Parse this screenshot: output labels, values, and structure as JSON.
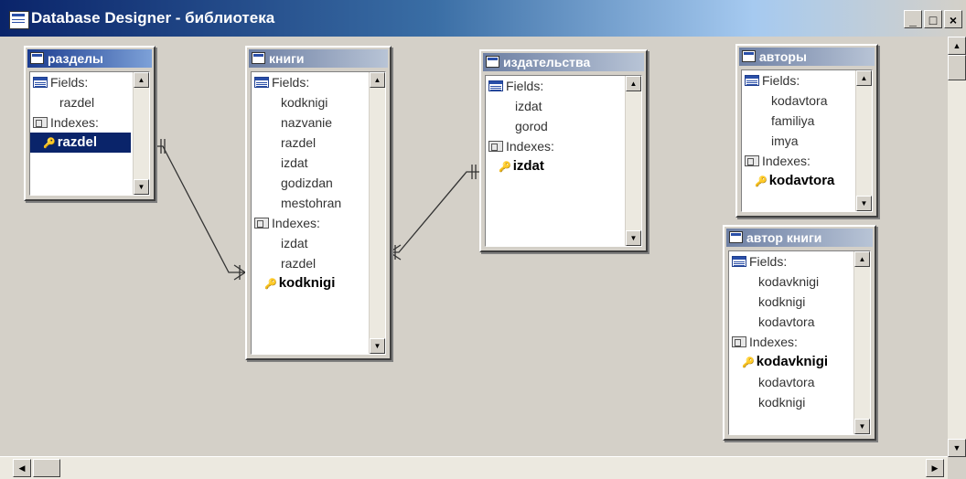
{
  "window": {
    "title": "Database Designer - библиотека",
    "minimize": "_",
    "maximize": "□",
    "close": "×"
  },
  "tables": [
    {
      "id": "razdely",
      "title": "разделы",
      "active": true,
      "fields_label": "Fields:",
      "fields": [
        "razdel"
      ],
      "indexes_label": "Indexes:",
      "indexes": [
        {
          "name": "razdel",
          "primary": true,
          "selected": true
        }
      ]
    },
    {
      "id": "knigi",
      "title": "книги",
      "active": false,
      "fields_label": "Fields:",
      "fields": [
        "kodknigi",
        "nazvanie",
        "razdel",
        "izdat",
        "godizdan",
        "mestohran"
      ],
      "indexes_label": "Indexes:",
      "indexes": [
        {
          "name": "izdat",
          "primary": false
        },
        {
          "name": "razdel",
          "primary": false
        },
        {
          "name": "kodknigi",
          "primary": true
        }
      ]
    },
    {
      "id": "izdatelstva",
      "title": "издательства",
      "active": false,
      "fields_label": "Fields:",
      "fields": [
        "izdat",
        "gorod"
      ],
      "indexes_label": "Indexes:",
      "indexes": [
        {
          "name": "izdat",
          "primary": true
        }
      ]
    },
    {
      "id": "avtory",
      "title": "авторы",
      "active": false,
      "fields_label": "Fields:",
      "fields": [
        "kodavtora",
        "familiya",
        "imya"
      ],
      "indexes_label": "Indexes:",
      "indexes": [
        {
          "name": "kodavtora",
          "primary": true
        }
      ]
    },
    {
      "id": "avtorknigi",
      "title": "автор книги",
      "active": false,
      "fields_label": "Fields:",
      "fields": [
        "kodavknigi",
        "kodknigi",
        "kodavtora"
      ],
      "indexes_label": "Indexes:",
      "indexes": [
        {
          "name": "kodavknigi",
          "primary": true
        },
        {
          "name": "kodavtora",
          "primary": false
        },
        {
          "name": "kodknigi",
          "primary": false
        }
      ]
    }
  ],
  "relations": [
    {
      "from": "razdely.razdel",
      "to": "knigi.razdel"
    },
    {
      "from": "izdatelstva.izdat",
      "to": "knigi.izdat"
    }
  ],
  "icons": {
    "fields": "fields-icon",
    "indexes": "indexes-icon",
    "primary_key": "key-icon"
  }
}
